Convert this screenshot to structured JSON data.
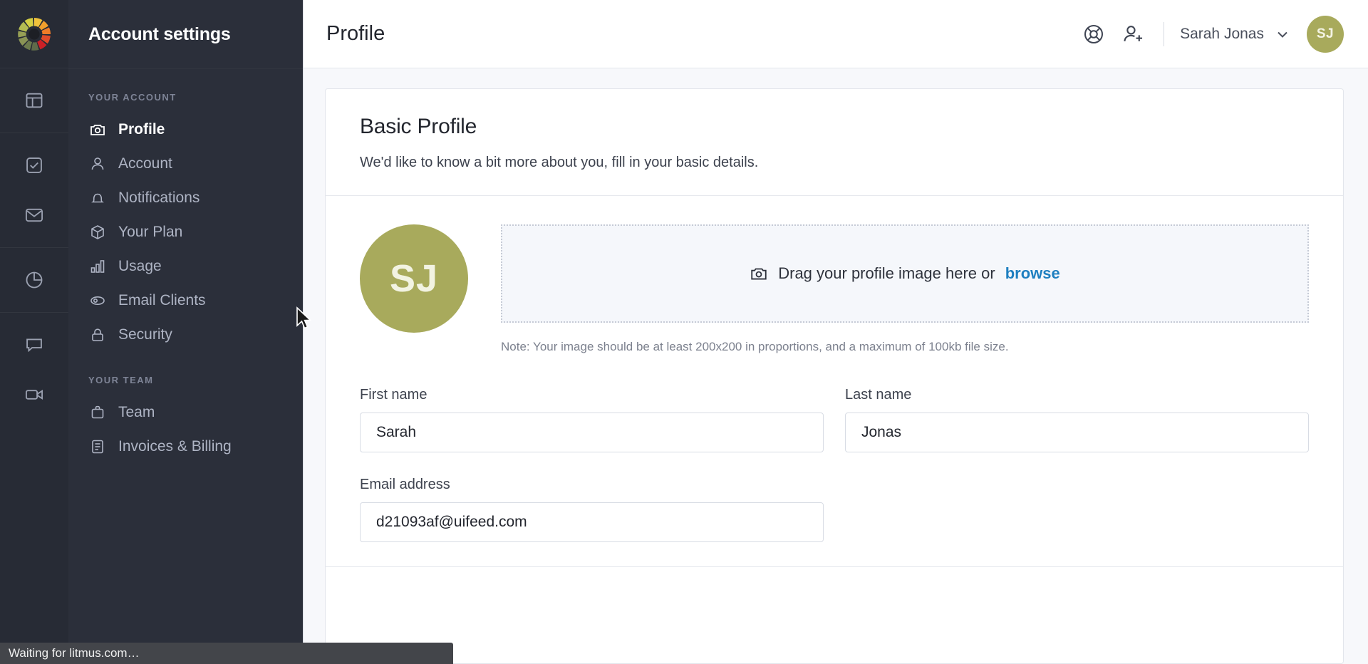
{
  "app": {
    "logo_icon": "color-wheel-logo",
    "status_text": "Waiting for litmus.com…"
  },
  "rail": {
    "groups": [
      {
        "items": [
          {
            "icon": "layout-icon",
            "name": "dashboard"
          }
        ]
      },
      {
        "items": [
          {
            "icon": "checkbox-icon",
            "name": "checklist"
          },
          {
            "icon": "envelope-icon",
            "name": "email"
          }
        ]
      },
      {
        "items": [
          {
            "icon": "pie-chart-icon",
            "name": "analytics"
          }
        ]
      },
      {
        "items": [
          {
            "icon": "speech-bubble-icon",
            "name": "messages"
          },
          {
            "icon": "video-camera-icon",
            "name": "video"
          }
        ]
      }
    ]
  },
  "sidebar": {
    "title": "Account settings",
    "sections": [
      {
        "heading": "YOUR ACCOUNT",
        "items": [
          {
            "label": "Profile",
            "icon": "camera-icon",
            "active": true
          },
          {
            "label": "Account",
            "icon": "user-icon",
            "active": false
          },
          {
            "label": "Notifications",
            "icon": "bell-icon",
            "active": false
          },
          {
            "label": "Your Plan",
            "icon": "box-icon",
            "active": false
          },
          {
            "label": "Usage",
            "icon": "bar-chart-icon",
            "active": false
          },
          {
            "label": "Email Clients",
            "icon": "eye-icon",
            "active": false
          },
          {
            "label": "Security",
            "icon": "lock-icon",
            "active": false
          }
        ]
      },
      {
        "heading": "YOUR TEAM",
        "items": [
          {
            "label": "Team",
            "icon": "briefcase-icon",
            "active": false
          },
          {
            "label": "Invoices & Billing",
            "icon": "document-list-icon",
            "active": false
          }
        ]
      }
    ]
  },
  "topbar": {
    "page_title": "Profile",
    "help_icon": "lifebuoy-icon",
    "add_user_icon": "add-user-icon",
    "user_name": "Sarah Jonas",
    "caret_icon": "chevron-down-icon",
    "avatar_initials": "SJ",
    "avatar_color": "#a8aa5c"
  },
  "card": {
    "title": "Basic Profile",
    "subtitle": "We'd like to know a bit more about you, fill in your basic details.",
    "avatar_initials": "SJ",
    "dropzone": {
      "icon": "camera-icon",
      "text": "Drag your profile image here or",
      "link": "browse",
      "link_color": "#1e7fc0",
      "note": "Note: Your image should be at least 200x200 in proportions, and a maximum of 100kb file size."
    },
    "fields": {
      "first_name": {
        "label": "First name",
        "value": "Sarah",
        "placeholder": "First name"
      },
      "last_name": {
        "label": "Last name",
        "value": "Jonas",
        "placeholder": "Last name"
      },
      "email": {
        "label": "Email address",
        "value": "d21093af@uifeed.com",
        "placeholder": "Email address"
      }
    }
  }
}
